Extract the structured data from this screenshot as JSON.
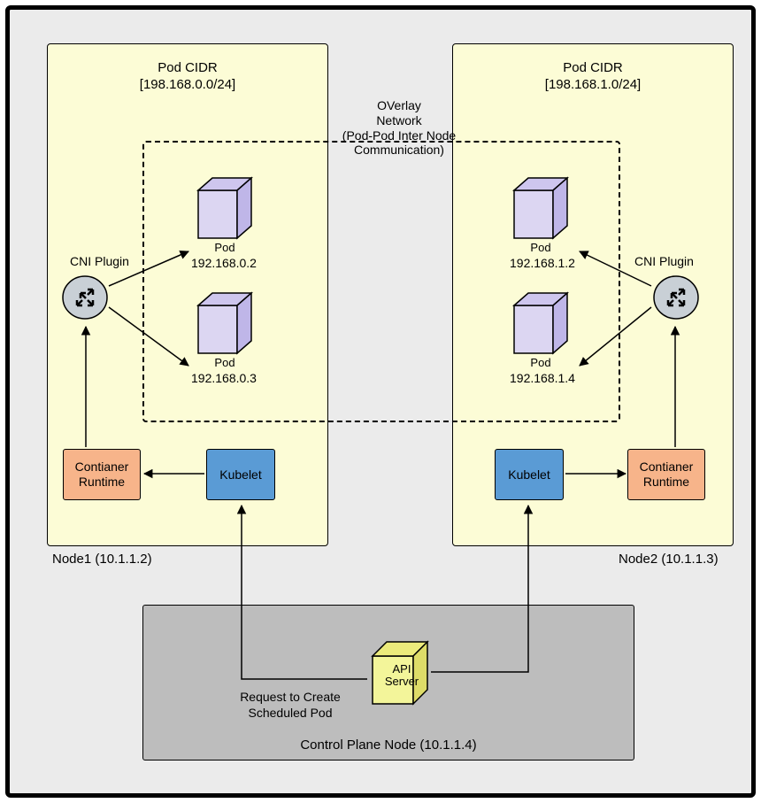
{
  "node1": {
    "cidr_title": "Pod CIDR",
    "cidr_range": "[198.168.0.0/24]",
    "cni_label": "CNI Plugin",
    "pod_a": {
      "label": "Pod",
      "ip": "192.168.0.2"
    },
    "pod_b": {
      "label": "Pod",
      "ip": "192.168.0.3"
    },
    "runtime_label": "Contianer\nRuntime",
    "kubelet_label": "Kubelet",
    "caption": "Node1 (10.1.1.2)"
  },
  "node2": {
    "cidr_title": "Pod CIDR",
    "cidr_range": "[198.168.1.0/24]",
    "cni_label": "CNI Plugin",
    "pod_a": {
      "label": "Pod",
      "ip": "192.168.1.2"
    },
    "pod_b": {
      "label": "Pod",
      "ip": "192.168.1.4"
    },
    "runtime_label": "Contianer\nRuntime",
    "kubelet_label": "Kubelet",
    "caption": "Node2 (10.1.1.3)"
  },
  "overlay": {
    "line1": "OVerlay",
    "line2": "Network",
    "line3": "(Pod-Pod Inter Node",
    "line4": "Communication)"
  },
  "control_plane": {
    "api_label": "API\nServer",
    "request_label": "Request to Create\nScheduled Pod",
    "caption": "Control Plane Node  (10.1.1.4)"
  }
}
